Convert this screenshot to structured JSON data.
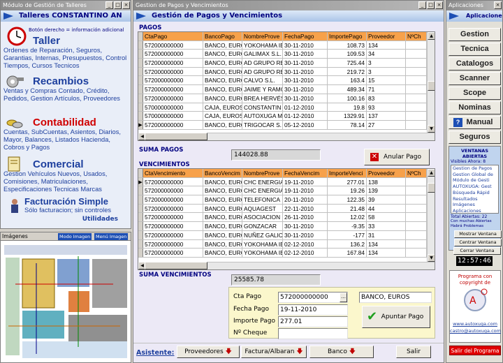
{
  "left_window": {
    "title": "Módulo de Gestión de Talleres",
    "header": "Talleres CONSTANTINO AN",
    "hint": "Botón derecho = información adicional",
    "modules": [
      {
        "name": "Taller",
        "desc": "Ordenes de Reparación, Seguros, Garantias, Internas, Presupuestos, Control Tiempos, Cursos Tecnicos",
        "color": "#1d3f9e"
      },
      {
        "name": "Recambios",
        "desc": "Ventas y Compras Contado, Crédito, Pedidos,  Gestion Artículos, Proveedores",
        "color": "#1d3f9e"
      },
      {
        "name": "Contabilidad",
        "desc": "Cuentas, SubCuentas, Asientos, Diarios, Mayor, Balances, Listados Hacienda, Cobros y Pagos",
        "color": "#d00000"
      },
      {
        "name": "Comercial",
        "desc": "Gestion Vehículos Nuevos, Usados, Comisiones, Matriculaciones, Especificaciones Tecnicas Marcas",
        "color": "#1d3f9e"
      },
      {
        "name": "Facturación Simple",
        "desc": "Sólo facturacion; sin controles",
        "color": "#1d3f9e"
      }
    ],
    "utilidades": "Utilidades"
  },
  "images_window": {
    "title": "Imágenes",
    "mode_label": "Modo Imagen",
    "menu_label": "Menú Imagen"
  },
  "central": {
    "title": "Gestion de Pagos y Vencimientos",
    "header": "Gestión de Pagos y Vencimientos",
    "pagos_label": "PAGOS",
    "pagos_columns": [
      "CtaPago",
      "BancoPago",
      "NombreProve",
      "FechaPago",
      "ImportePago",
      "Proveedor",
      "NºCh"
    ],
    "pagos_rows": [
      [
        "572000000000",
        "BANCO, EURO",
        "YOKOHAMA IB",
        "30-11-2010",
        "108.73",
        "134"
      ],
      [
        "572000000000",
        "BANCO, EURO",
        "GALIMAX S.L.",
        "30-11-2010",
        "109.53",
        "34"
      ],
      [
        "572000000000",
        "BANCO, EURO",
        "AD GRUPO RE",
        "30-11-2010",
        "725.44",
        "3"
      ],
      [
        "572000000000",
        "BANCO, EURO",
        "AD GRUPO RE",
        "30-11-2010",
        "219.72",
        "3"
      ],
      [
        "572000000000",
        "BANCO, EURO",
        "CALVO S.L.",
        "30-11-2010",
        "163.4",
        "15"
      ],
      [
        "572000000000",
        "BANCO, EURO",
        "JAIME Y RAMO",
        "30-11-2010",
        "489.34",
        "71"
      ],
      [
        "572000000000",
        "BANCO, EURO",
        "BREA HERVÉS",
        "30-11-2010",
        "100.16",
        "83"
      ],
      [
        "570000000000",
        "CAJA, EUROS",
        "CONSTANTIN",
        "01-12-2010",
        "19.8",
        "93"
      ],
      [
        "570000000000",
        "CAJA, EUROS",
        "AUTOXUGA M",
        "01-12-2010",
        "1329.91",
        "137"
      ],
      [
        "572000000000",
        "BANCO, EURO",
        "TRIGOCAR S.",
        "05-12-2010",
        "78.14",
        "27"
      ]
    ],
    "pagos_selected": 9,
    "suma_pagos_label": "SUMA PAGOS",
    "suma_pagos": "144028.88",
    "anular_label": "Anular Pago",
    "venc_label": "VENCIMIENTOS",
    "venc_columns": [
      "CtaVencimiento",
      "BancoVencim",
      "NombreProve",
      "FechaVencim",
      "ImporteVenci",
      "Proveedor",
      "NºCh"
    ],
    "venc_rows": [
      [
        "572000000000",
        "BANCO, EURO",
        "CHC ENERGIA",
        "19-11-2010",
        "277.01",
        "138"
      ],
      [
        "572000000000",
        "BANCO, EURO",
        "CHC ENERGIA",
        "19-11-2010",
        "19.26",
        "139"
      ],
      [
        "572000000000",
        "BANCO, EURO",
        "TELEFONICA",
        "20-11-2010",
        "122.35",
        "39"
      ],
      [
        "572000000000",
        "BANCO, EURO",
        "AQUAGEST",
        "22-11-2010",
        "21.48",
        "44"
      ],
      [
        "572000000000",
        "BANCO, EURO",
        "ASOCIACION",
        "26-11-2010",
        "12.02",
        "58"
      ],
      [
        "572000000000",
        "BANCO, EURO",
        "GONZACAR",
        "30-11-2010",
        "-9.35",
        "33"
      ],
      [
        "572000000000",
        "BANCO, EURO",
        "NUÑEZ GALIC",
        "30-11-2010",
        "-177",
        "31"
      ],
      [
        "572000000000",
        "BANCO, EURO",
        "YOKOHAMA IB",
        "02-12-2010",
        "136.2",
        "134"
      ],
      [
        "572000000000",
        "BANCO, EURO",
        "YOKOHAMA IB",
        "02-12-2010",
        "167.84",
        "134"
      ]
    ],
    "venc_selected": 0,
    "suma_venc_label": "SUMA VENCIMIENTOS",
    "suma_venc": "25585.78",
    "form": {
      "cta_label": "Cta Pago",
      "cta_value": "572000000000",
      "banco_value": "BANCO, EUROS",
      "fecha_label": "Fecha Pago",
      "fecha_value": "19-11-2010",
      "importe_label": "Importe Pago",
      "importe_value": "277.01",
      "cheque_label": "Nº Cheque",
      "cheque_value": "",
      "apuntar_label": "Apuntar Pago"
    },
    "asistente_label": "Asistente:",
    "bottom_buttons": [
      "Proveedores",
      "Factura/Albaran",
      "Banco"
    ],
    "salir_label": "Salir"
  },
  "right": {
    "title": "Aplicaciones",
    "header": "Aplicaciones",
    "buttons": [
      "Gestion",
      "Tecnica",
      "Catalogos",
      "Scanner",
      "Scope",
      "Nominas",
      "Manual",
      "Seguros"
    ],
    "help_glyph": "?",
    "ventanas_title": "VENTANAS ABIERTAS",
    "visibles": "Visibles Ahora: 8",
    "windows_list": [
      "Gestion de Pagos",
      "Gestion Global de",
      "Módulo de Gesti",
      "AUTOXUGA: Gest",
      "Búsqueda Rápid",
      "Resultados",
      "Imágenes",
      "Aplicaciones"
    ],
    "total": "Total Abiertas: 22",
    "warning": "Con muchas Abiertas Habrá Problemas",
    "mostrar": "Mostrar Ventana",
    "centrar": "Centrar Ventana",
    "cerrar": "Cerrar Ventana",
    "clock": "12:57:46",
    "program_text": "Programa con copyright de",
    "web": "www.autoxuga.com",
    "email": "castro@autoxuga.com",
    "salir_programa": "Salir del Programa"
  }
}
